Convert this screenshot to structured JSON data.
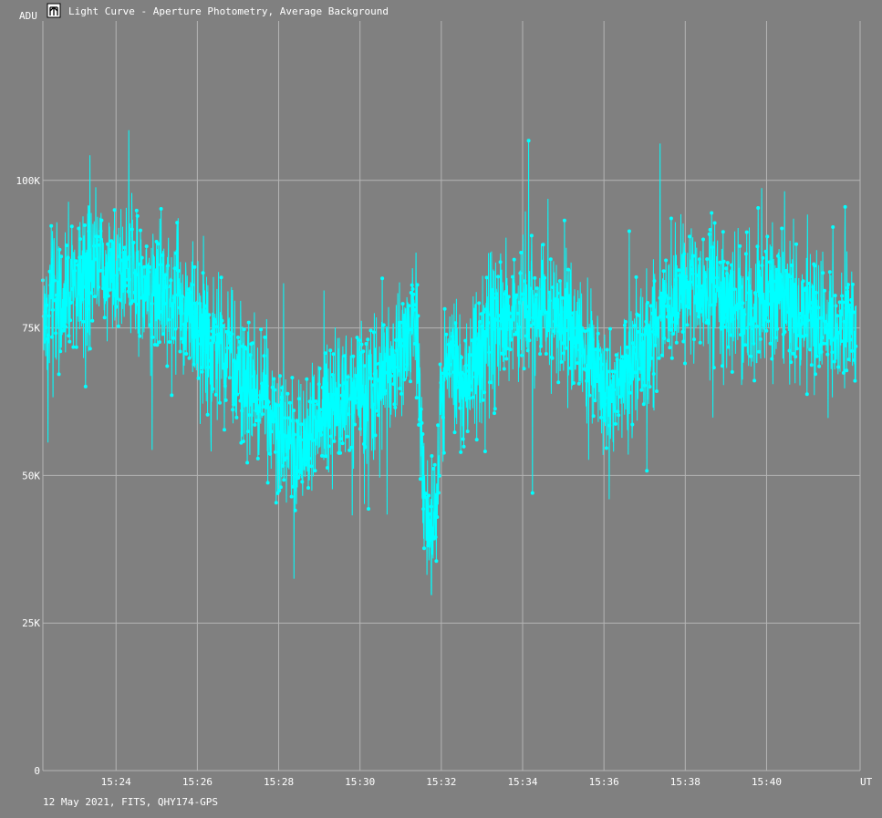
{
  "window": {
    "icon": "app-logo-icon",
    "title": "Light Curve - Aperture Photometry, Average Background"
  },
  "footer": {
    "caption": "12 May 2021, FITS, QHY174-GPS"
  },
  "colors": {
    "background": "#808080",
    "grid": "#b4b4b4",
    "series": "#00ffff",
    "text": "#ffffff"
  },
  "chart_data": {
    "type": "line",
    "title": "Light Curve - Aperture Photometry, Average Background",
    "xlabel": "UT",
    "ylabel": "ADU",
    "x_unit": "minutes past 15:00 UT",
    "xlim": [
      22.2,
      42.3
    ],
    "ylim": [
      0,
      127000
    ],
    "x_ticks": [
      24,
      26,
      28,
      30,
      32,
      34,
      36,
      38,
      40
    ],
    "x_tick_labels": [
      "15:24",
      "15:26",
      "15:28",
      "15:30",
      "15:32",
      "15:34",
      "15:36",
      "15:38",
      "15:40"
    ],
    "y_ticks": [
      0,
      25000,
      50000,
      75000,
      100000
    ],
    "y_tick_labels": [
      "0",
      "25K",
      "50K",
      "75K",
      "100K"
    ],
    "grid": true,
    "markers": true,
    "series": [
      {
        "x": [
          22.2,
          22.6,
          23.0,
          23.5,
          24.0,
          24.5,
          25.0,
          25.5,
          26.0,
          26.4,
          26.8,
          27.2,
          27.6,
          28.0,
          28.4,
          28.8,
          29.2,
          29.6,
          30.0,
          30.4,
          30.8,
          31.2,
          31.4,
          31.5,
          31.6,
          31.7,
          31.8,
          31.9,
          32.0,
          32.2,
          32.5,
          32.8,
          33.2,
          33.6,
          34.0,
          34.4,
          34.8,
          35.2,
          35.6,
          36.0,
          36.2,
          36.6,
          37.0,
          37.4,
          37.8,
          38.2,
          38.6,
          39.0,
          39.4,
          39.8,
          40.2,
          40.6,
          41.0,
          41.4,
          41.8,
          42.2
        ],
        "y": [
          77000,
          80000,
          83000,
          86000,
          85000,
          83000,
          82000,
          80000,
          76000,
          71000,
          69000,
          67000,
          63000,
          57000,
          54000,
          57000,
          61000,
          63000,
          64000,
          67000,
          70000,
          74000,
          76000,
          55000,
          45000,
          41000,
          40000,
          45000,
          64000,
          70000,
          66000,
          69000,
          75000,
          77000,
          78000,
          78000,
          76000,
          74000,
          71000,
          65000,
          64000,
          68000,
          72000,
          77000,
          81000,
          82000,
          81000,
          79000,
          78000,
          80000,
          81000,
          79000,
          78000,
          76000,
          74000,
          76000
        ],
        "scatter": 12000
      }
    ]
  }
}
